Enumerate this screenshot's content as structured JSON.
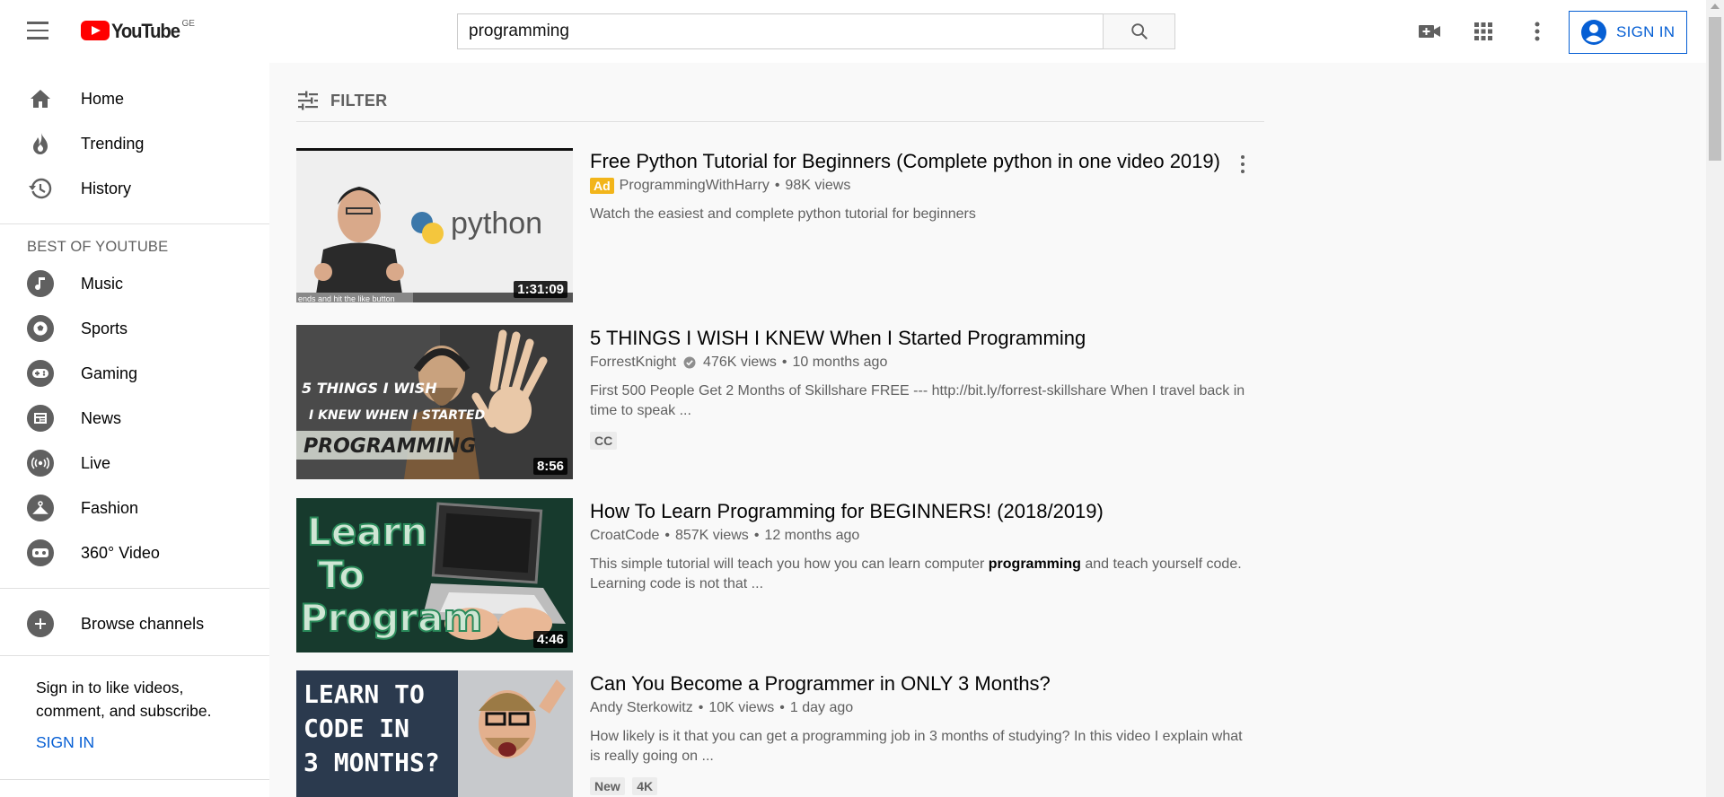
{
  "header": {
    "logo_text": "YouTube",
    "country_code": "GE",
    "search_value": "programming",
    "signin_label": "SIGN IN"
  },
  "sidebar": {
    "main_items": [
      {
        "label": "Home",
        "icon": "home-icon"
      },
      {
        "label": "Trending",
        "icon": "flame-icon"
      },
      {
        "label": "History",
        "icon": "history-icon"
      }
    ],
    "best_heading": "BEST OF YOUTUBE",
    "best_items": [
      {
        "label": "Music",
        "icon": "music-icon"
      },
      {
        "label": "Sports",
        "icon": "sports-icon"
      },
      {
        "label": "Gaming",
        "icon": "gaming-icon"
      },
      {
        "label": "News",
        "icon": "news-icon"
      },
      {
        "label": "Live",
        "icon": "live-icon"
      },
      {
        "label": "Fashion",
        "icon": "fashion-icon"
      },
      {
        "label": "360° Video",
        "icon": "360-video-icon"
      }
    ],
    "browse_channels": "Browse channels",
    "signin_prompt": "Sign in to like videos, comment, and subscribe.",
    "signin_link": "SIGN IN"
  },
  "filter_label": "FILTER",
  "results": [
    {
      "title": "Free Python Tutorial for Beginners (Complete python in one video 2019)",
      "ad_label": "Ad",
      "channel": "ProgrammingWithHarry",
      "views": "98K views",
      "description": "Watch the easiest and complete python tutorial for beginners",
      "duration": "1:31:09",
      "thumb_text": "python",
      "thumb_caption": "ends and hit the like button"
    },
    {
      "title": "5 THINGS I WISH I KNEW When I Started Programming",
      "channel": "ForrestKnight",
      "views": "476K views",
      "age": "10 months ago",
      "description": "First 500 People Get 2 Months of Skillshare FREE --- http://bit.ly/forrest-skillshare When I travel back in time to speak ...",
      "badges": [
        "CC"
      ],
      "duration": "8:56",
      "thumb_lines": [
        "5 THINGS I WISH",
        "I KNEW WHEN I STARTED",
        "PROGRAMMING"
      ]
    },
    {
      "title": "How To Learn Programming for BEGINNERS! (2018/2019)",
      "channel": "CroatCode",
      "views": "857K views",
      "age": "12 months ago",
      "description_before": "This simple tutorial will teach you how you can learn computer ",
      "description_bold": "programming",
      "description_after": " and teach yourself code. Learning code is not that ...",
      "duration": "4:46",
      "thumb_lines": [
        "Learn",
        "To",
        "Program"
      ]
    },
    {
      "title": "Can You Become a Programmer in ONLY 3 Months?",
      "channel": "Andy Sterkowitz",
      "views": "10K views",
      "age": "1 day ago",
      "description": "How likely is it that you can get a programming job in 3 months of studying? In this video I explain what is really going on ...",
      "badges": [
        "New",
        "4K"
      ],
      "thumb_lines": [
        "LEARN TO",
        "CODE IN",
        "3 MONTHS?"
      ]
    }
  ],
  "colors": {
    "brand_red": "#ff0000",
    "link_blue": "#065fd4",
    "ad_yellow": "#f2b51a"
  }
}
